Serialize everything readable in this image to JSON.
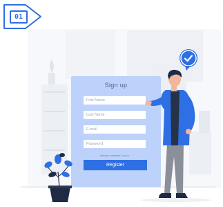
{
  "badge": {
    "label": "01"
  },
  "form": {
    "title": "Sign up",
    "fields": {
      "first_name": "First Name",
      "last_name": "Last Name",
      "email": "E-mail",
      "password": "Password"
    },
    "login_hint": "Already a member? Log In",
    "register_label": "Register"
  },
  "colors": {
    "accent": "#2f6fe4",
    "card": "#bcd2fb",
    "background_shapes": "#f4f5f8"
  }
}
